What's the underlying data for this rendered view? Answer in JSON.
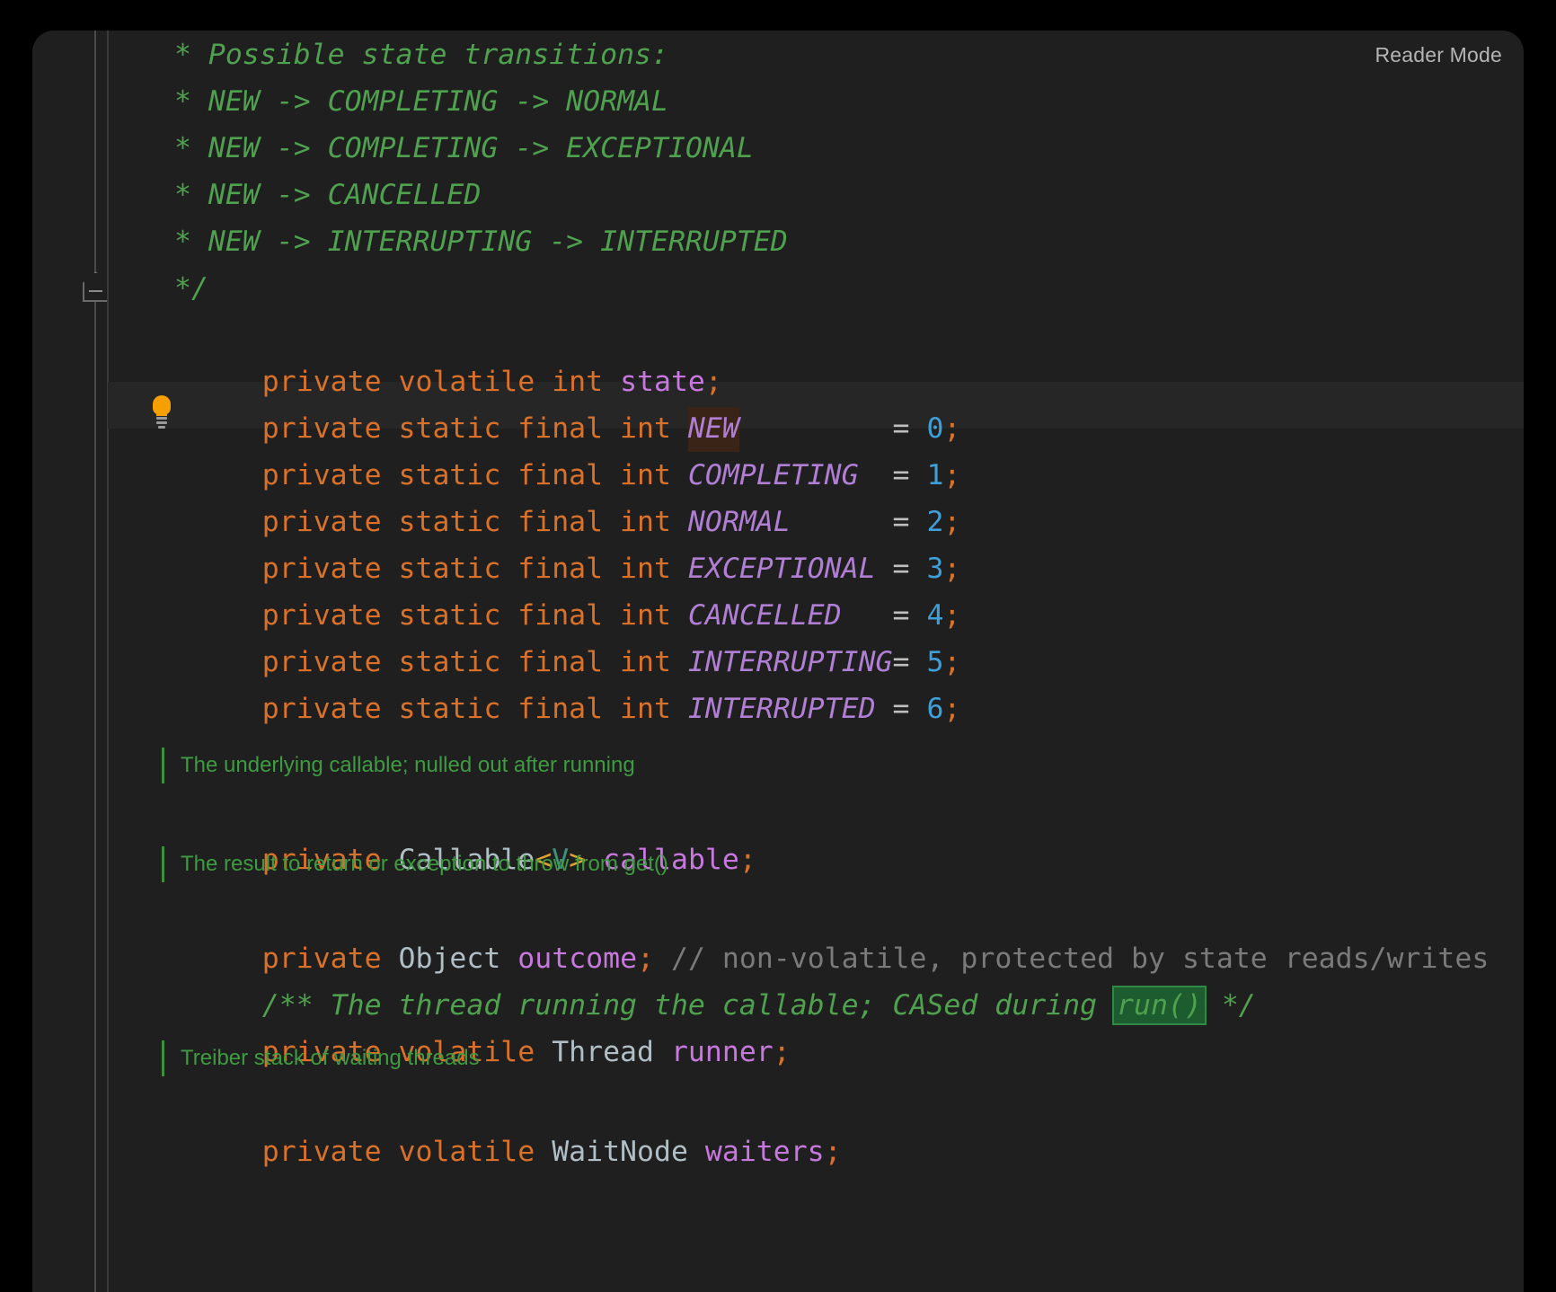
{
  "window": {
    "reader_mode_label": "Reader Mode",
    "background_color": "#1f1f1f",
    "page_background_color": "#000000",
    "caret_line_color": "#262626"
  },
  "gutter": {
    "fold_marker_icon": "code-fold-collapse-icon",
    "intention_icon": "lightbulb-icon",
    "intention_icon_color": "#f5a000"
  },
  "colors": {
    "comment": "#4fa14f",
    "keyword": "#d9712a",
    "field": "#c678dd",
    "constant": "#b07fd4",
    "number": "#3f9fd6",
    "operator": "#bfbfbf",
    "type": "#b0bec5",
    "line_comment": "#7a7a7a",
    "occurrence_highlight": "#3a2418",
    "find_highlight": "#1d5c2e",
    "doc_bar": "#3f8f3f"
  },
  "code": {
    "block_comment": [
      "* Possible state transitions:",
      "* NEW -> COMPLETING -> NORMAL",
      "* NEW -> COMPLETING -> EXCEPTIONAL",
      "* NEW -> CANCELLED",
      "* NEW -> INTERRUPTING -> INTERRUPTED",
      "*/"
    ],
    "state_field": {
      "keywords": "private volatile int",
      "name": "state",
      "semi": ";"
    },
    "constants_declaration_prefix": "private static final int",
    "constants": [
      {
        "name": "NEW",
        "pad": "         ",
        "eq": "=",
        "value": "0",
        "semi": ";",
        "highlighted": true
      },
      {
        "name": "COMPLETING",
        "pad": "  ",
        "eq": "=",
        "value": "1",
        "semi": ";",
        "highlighted": false
      },
      {
        "name": "NORMAL",
        "pad": "      ",
        "eq": "=",
        "value": "2",
        "semi": ";",
        "highlighted": false
      },
      {
        "name": "EXCEPTIONAL",
        "pad": " ",
        "eq": "=",
        "value": "3",
        "semi": ";",
        "highlighted": false
      },
      {
        "name": "CANCELLED",
        "pad": "   ",
        "eq": "=",
        "value": "4",
        "semi": ";",
        "highlighted": false
      },
      {
        "name": "INTERRUPTING",
        "pad": "",
        "eq": "=",
        "value": "5",
        "semi": ";",
        "highlighted": false
      },
      {
        "name": "INTERRUPTED",
        "pad": " ",
        "eq": "=",
        "value": "6",
        "semi": ";",
        "highlighted": false
      }
    ],
    "doc_callable": "The underlying callable; nulled out after running",
    "callable_field": {
      "kw": "private",
      "type": "Callable",
      "lt": "<",
      "generic": "V",
      "gt": ">",
      "name": "callable",
      "semi": ";"
    },
    "doc_outcome": "The result to return or exception to throw from get()",
    "outcome_field": {
      "kw": "private",
      "type": "Object",
      "name": "outcome",
      "semi": ";",
      "comment": "// non-volatile, protected by state reads/writes"
    },
    "runner_doc_comment": {
      "before": "/** The thread running the callable; CASed during ",
      "match": "run()",
      "after": " */"
    },
    "runner_field": {
      "keywords": "private volatile",
      "type": "Thread",
      "name": "runner",
      "semi": ";"
    },
    "doc_waiters": "Treiber stack of waiting threads",
    "waiters_field": {
      "keywords": "private volatile",
      "type": "WaitNode",
      "name": "waiters",
      "semi": ";"
    }
  }
}
